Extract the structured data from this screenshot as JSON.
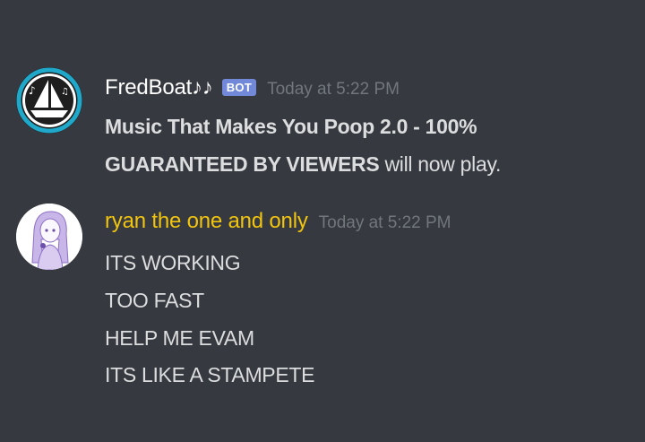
{
  "messages": [
    {
      "username": "FredBoat♪♪",
      "username_color": "#ffffff",
      "bot_tag": "BOT",
      "timestamp": "Today at 5:22 PM",
      "avatar": "fredboat-ship-icon",
      "content": {
        "line1": "Music That Makes You Poop 2.0 - 100%",
        "line2_bold": "GUARANTEED BY VIEWERS",
        "line2_rest": " will now play."
      }
    },
    {
      "username": "ryan the one and only",
      "username_color": "#f1c40f",
      "timestamp": "Today at 5:22 PM",
      "avatar": "anime-girl-avatar",
      "lines": [
        "ITS WORKING",
        "TOO FAST",
        "HELP ME EVAM",
        "ITS LIKE A STAMPETE"
      ]
    }
  ],
  "colors": {
    "background": "#36393f",
    "text": "#dcddde",
    "timestamp": "#72767d",
    "bot_tag": "#7289da",
    "fredboat_ring": "#1fa8c9"
  }
}
